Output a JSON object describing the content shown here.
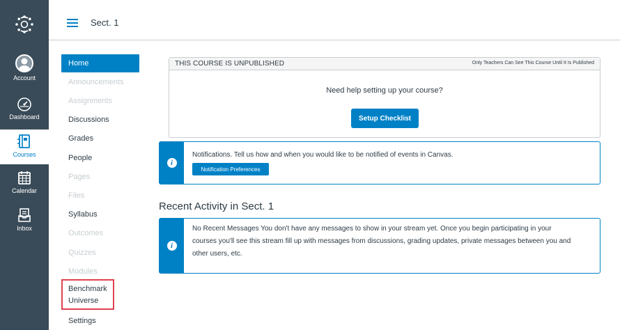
{
  "global_nav": {
    "items": [
      {
        "label": "Account",
        "icon": "user-avatar-icon"
      },
      {
        "label": "Dashboard",
        "icon": "dashboard-gauge-icon"
      },
      {
        "label": "Courses",
        "icon": "courses-book-icon"
      },
      {
        "label": "Calendar",
        "icon": "calendar-icon"
      },
      {
        "label": "Inbox",
        "icon": "inbox-icon"
      }
    ],
    "accent": "#0081c6",
    "background": "#394b58"
  },
  "header": {
    "course_title": "Sect. 1"
  },
  "course_nav": {
    "items": [
      {
        "label": "Home"
      },
      {
        "label": "Announcements"
      },
      {
        "label": "Assignments"
      },
      {
        "label": "Discussions"
      },
      {
        "label": "Grades"
      },
      {
        "label": "People"
      },
      {
        "label": "Pages"
      },
      {
        "label": "Files"
      },
      {
        "label": "Syllabus"
      },
      {
        "label": "Outcomes"
      },
      {
        "label": "Quizzes"
      },
      {
        "label": "Modules"
      },
      {
        "label": "Benchmark Universe"
      },
      {
        "label": "Settings"
      }
    ],
    "highlight_color": "#e0414f"
  },
  "unpublished": {
    "title": "THIS COURSE IS UNPUBLISHED",
    "note": "Only Teachers Can See This Course Until It Is Published",
    "help_text": "Need help setting up your course?",
    "button_label": "Setup Checklist"
  },
  "notifications": {
    "text": "Notifications.  Tell us how and when you would like to be notified of events in Canvas.",
    "button_label": "Notification Preferences"
  },
  "recent_activity": {
    "heading": "Recent Activity in Sect. 1",
    "message_line1": "No Recent Messages  You don't have any messages to show in your stream yet. Once you begin participating in your",
    "message_line2": "courses you'll see this stream fill up with messages from discussions, grading updates, private messages between you and",
    "message_line3": "other users, etc."
  }
}
